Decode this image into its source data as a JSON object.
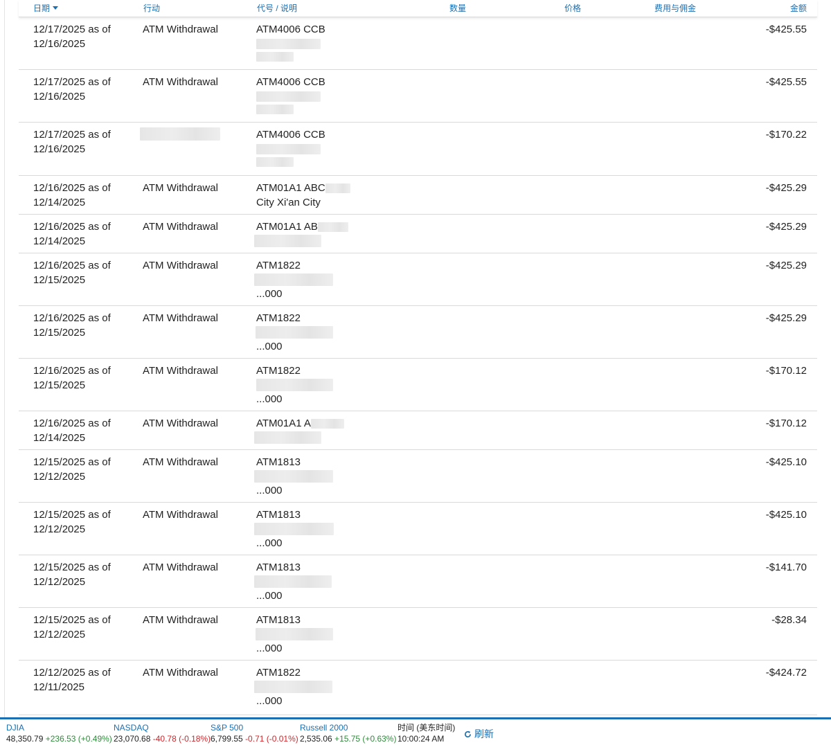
{
  "header": {
    "date": "日期",
    "action": "行动",
    "symbol_desc": "代号 / 说明",
    "quantity": "数量",
    "price": "价格",
    "fees": "费用与佣金",
    "amount": "金额"
  },
  "rows": [
    {
      "date1": "12/17/2025 as of",
      "date2": "12/16/2025",
      "action": "ATM Withdrawal",
      "desc1": "ATM4006 CCB",
      "desc3": "",
      "amount": "-$425.55"
    },
    {
      "date1": "12/17/2025 as of",
      "date2": "12/16/2025",
      "action": "ATM Withdrawal",
      "desc1": "ATM4006 CCB",
      "desc3": "",
      "amount": "-$425.55"
    },
    {
      "date1": "12/17/2025 as of",
      "date2": "12/16/2025",
      "action": "",
      "desc1": "ATM4006 CCB",
      "desc3": "",
      "amount": "-$170.22"
    },
    {
      "date1": "12/16/2025 as of",
      "date2": "12/14/2025",
      "action": "ATM Withdrawal",
      "desc1": "ATM01A1 ABC",
      "desc2": "City Xi'an City",
      "amount": "-$425.29"
    },
    {
      "date1": "12/16/2025 as of",
      "date2": "12/14/2025",
      "action": "ATM Withdrawal",
      "desc1": "ATM01A1 AB",
      "amount": "-$425.29"
    },
    {
      "date1": "12/16/2025 as of",
      "date2": "12/15/2025",
      "action": "ATM Withdrawal",
      "desc1": "ATM1822",
      "desc3": "...000",
      "amount": "-$425.29"
    },
    {
      "date1": "12/16/2025 as of",
      "date2": "12/15/2025",
      "action": "ATM Withdrawal",
      "desc1": "ATM1822",
      "desc3": "...000",
      "amount": "-$425.29"
    },
    {
      "date1": "12/16/2025 as of",
      "date2": "12/15/2025",
      "action": "ATM Withdrawal",
      "desc1": "ATM1822",
      "desc3": "...000",
      "amount": "-$170.12"
    },
    {
      "date1": "12/16/2025 as of",
      "date2": "12/14/2025",
      "action": "ATM Withdrawal",
      "desc1": "ATM01A1 A",
      "amount": "-$170.12"
    },
    {
      "date1": "12/15/2025 as of",
      "date2": "12/12/2025",
      "action": "ATM Withdrawal",
      "desc1": "ATM1813",
      "desc3": "...000",
      "amount": "-$425.10"
    },
    {
      "date1": "12/15/2025 as of",
      "date2": "12/12/2025",
      "action": "ATM Withdrawal",
      "desc1": "ATM1813",
      "desc3": "...000",
      "amount": "-$425.10"
    },
    {
      "date1": "12/15/2025 as of",
      "date2": "12/12/2025",
      "action": "ATM Withdrawal",
      "desc1": "ATM1813",
      "desc3": "...000",
      "amount": "-$141.70"
    },
    {
      "date1": "12/15/2025 as of",
      "date2": "12/12/2025",
      "action": "ATM Withdrawal",
      "desc1": "ATM1813",
      "desc3": "...000",
      "amount": "-$28.34"
    },
    {
      "date1": "12/12/2025 as of",
      "date2": "12/11/2025",
      "action": "ATM Withdrawal",
      "desc1": "ATM1822",
      "desc3": "...000",
      "amount": "-$424.72"
    }
  ],
  "ticker": {
    "djia": {
      "name": "DJIA",
      "value": "48,350.79",
      "change": "+236.53 (+0.49%)",
      "direction": "up"
    },
    "nasdaq": {
      "name": "NASDAQ",
      "value": "23,070.68",
      "change": "-40.78 (-0.18%)",
      "direction": "down"
    },
    "sp500": {
      "name": "S&P 500",
      "value": "6,799.55",
      "change": "-0.71 (-0.01%)",
      "direction": "down"
    },
    "russell": {
      "name": "Russell 2000",
      "value": "2,535.06",
      "change": "+15.75 (+0.63%)",
      "direction": "up"
    },
    "time_label": "时间 (美东时间)",
    "time_value": "10:00:24 AM",
    "refresh_label": "刷新",
    "refresh_icon": "refresh-icon"
  },
  "colors": {
    "link": "#1a6fb3",
    "up": "#2e8b3a",
    "down": "#d0272c"
  }
}
